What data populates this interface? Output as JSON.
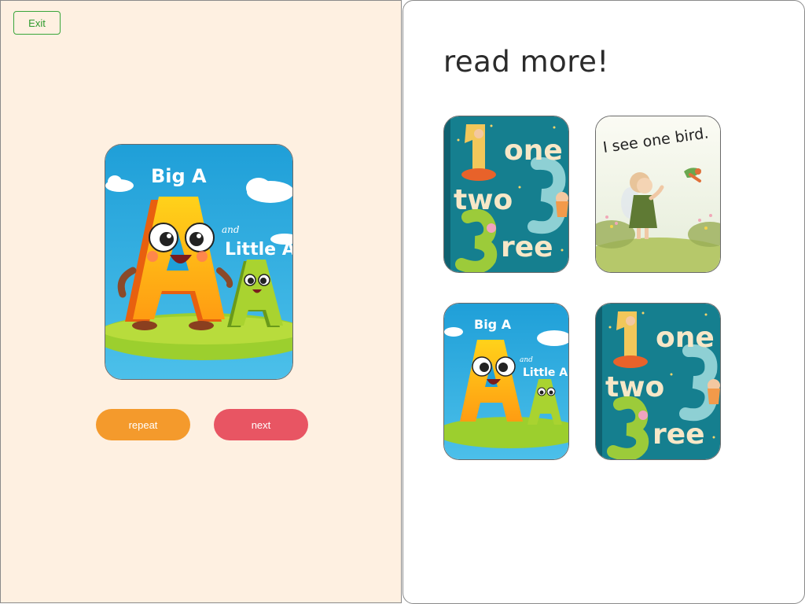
{
  "exit_label": "Exit",
  "main_book": {
    "title_line1": "Big A",
    "title_and": "and",
    "title_line2": "Little A"
  },
  "controls": {
    "repeat_label": "repeat",
    "next_label": "next"
  },
  "read_more": {
    "heading": "read more!",
    "books": [
      {
        "word1": "one",
        "word2": "two",
        "word3": "ree"
      },
      {
        "caption": "I see one bird."
      },
      {
        "title_line1": "Big A",
        "title_and": "and",
        "title_line2": "Little A"
      },
      {
        "word1": "one",
        "word2": "two",
        "word3": "ree"
      }
    ]
  },
  "colors": {
    "left_bg": "#fef0e1",
    "repeat": "#f49a2c",
    "next": "#e85563",
    "exit_green": "#3aa53a"
  }
}
